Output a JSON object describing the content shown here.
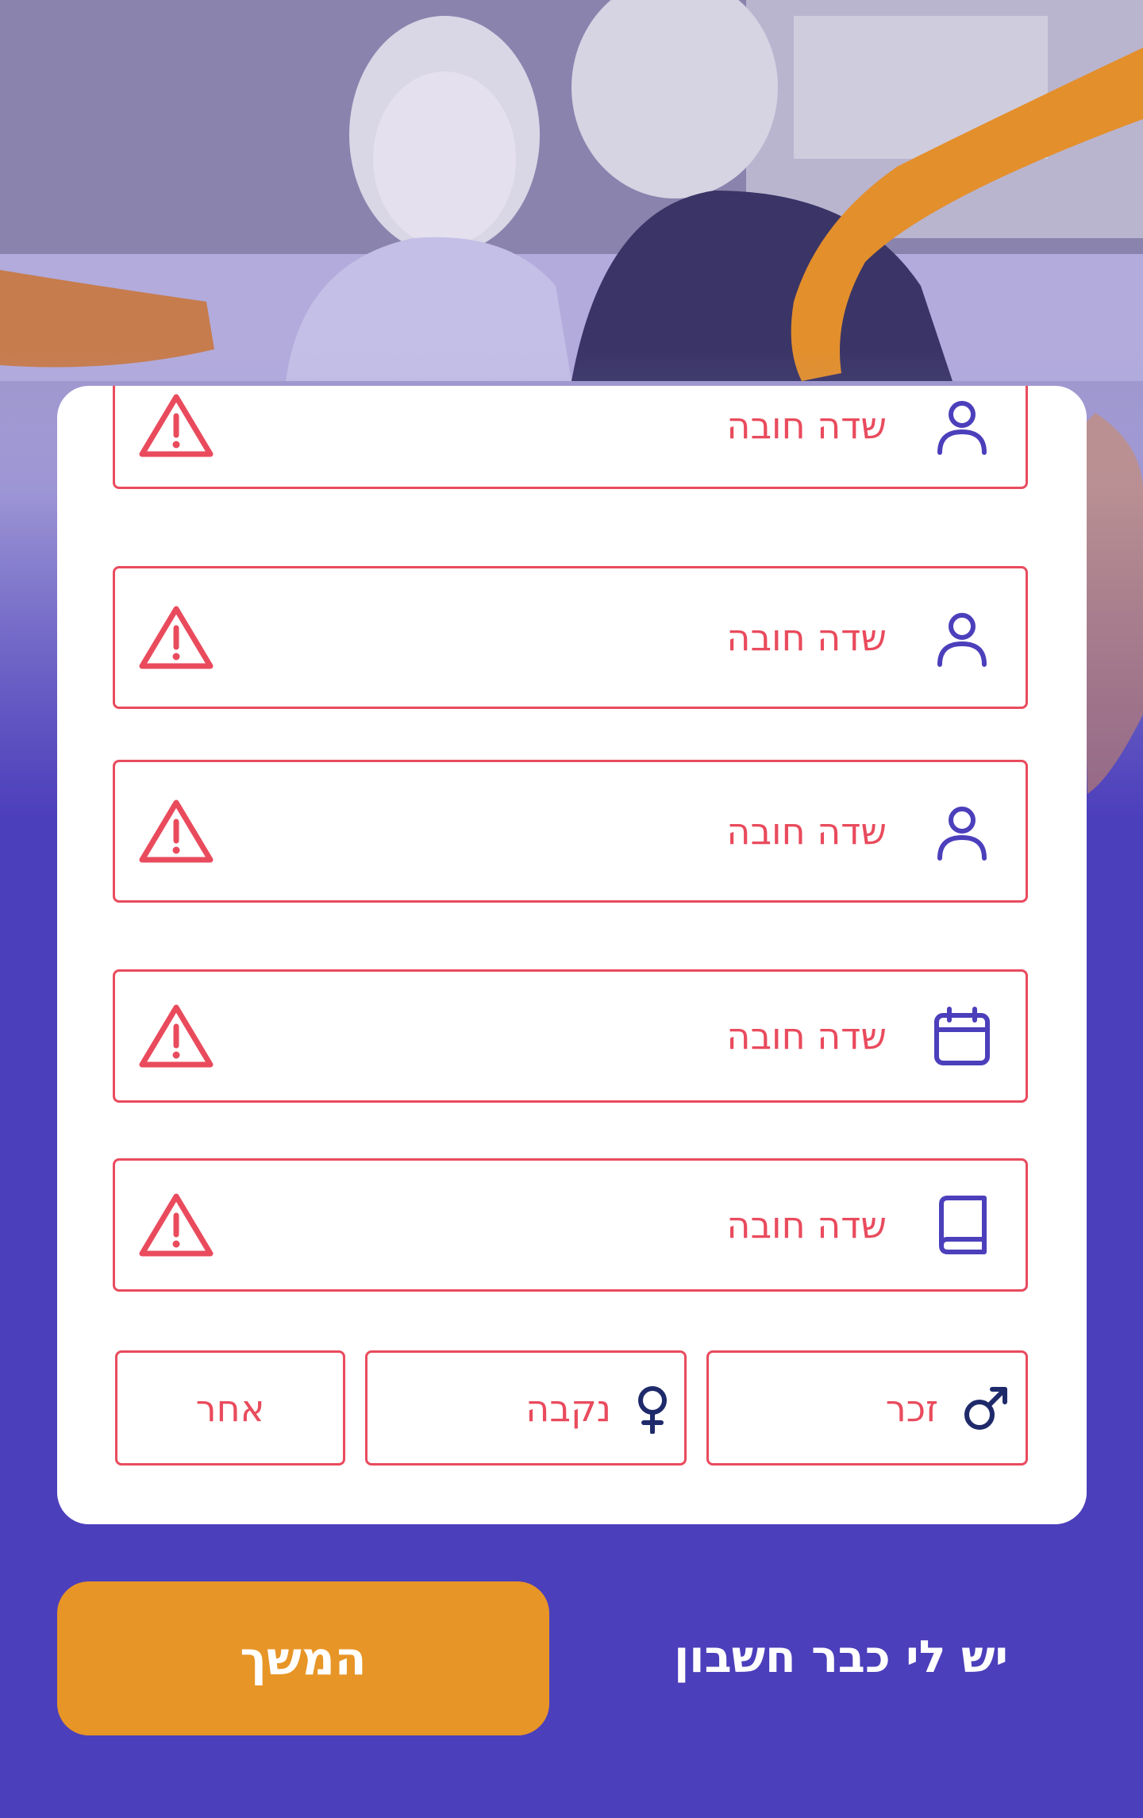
{
  "form": {
    "fields": [
      {
        "icon": "user-icon",
        "error": "שדה חובה"
      },
      {
        "icon": "user-icon",
        "error": "שדה חובה"
      },
      {
        "icon": "user-icon",
        "error": "שדה חובה"
      },
      {
        "icon": "calendar-icon",
        "error": "שדה חובה"
      },
      {
        "icon": "book-icon",
        "error": "שדה חובה"
      }
    ],
    "gender": {
      "male": {
        "label": "זכר",
        "icon": "male-symbol-icon"
      },
      "female": {
        "label": "נקבה",
        "icon": "female-symbol-icon"
      },
      "other": {
        "label": "אחר"
      }
    }
  },
  "actions": {
    "continue_label": "המשך",
    "login_link": "יש לי כבר חשבון"
  },
  "colors": {
    "background": "#4c3fbb",
    "accent": "#e79526",
    "error": "#e94b5d",
    "icon": "#4c3fbb"
  }
}
